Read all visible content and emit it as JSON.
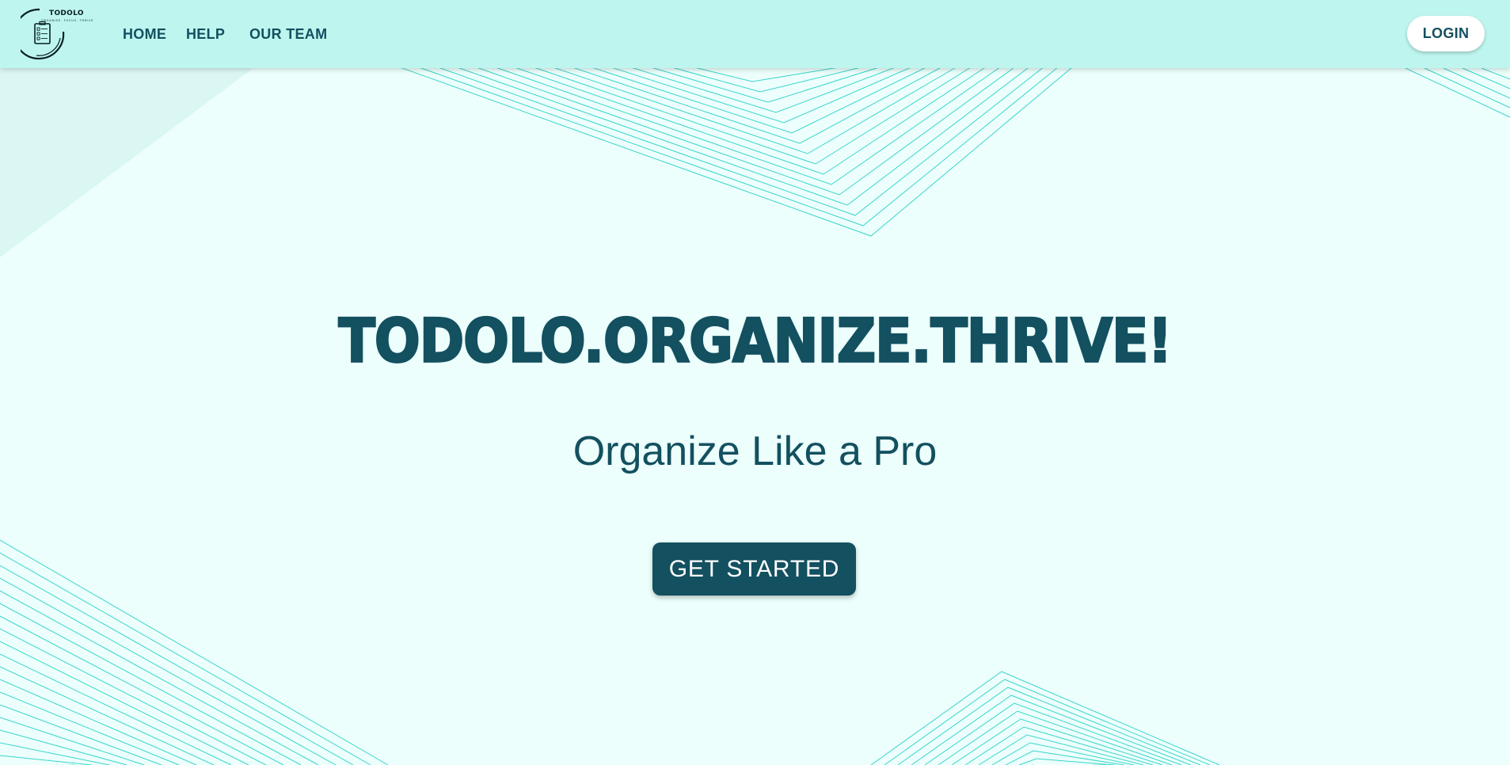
{
  "brand": {
    "name": "TODOLO",
    "tagline": "ORGANIZE. FOCUS. THRIVE"
  },
  "nav": {
    "home_label": "HOME",
    "help_label": "HELP",
    "team_label": "OUR TEAM",
    "login_label": "LOGIN"
  },
  "hero": {
    "title": "TODOLO.ORGANIZE.THRIVE!",
    "subtitle": "Organize Like a Pro",
    "cta_label": "GET STARTED"
  },
  "colors": {
    "navbar_bg": "#bef6ef",
    "page_bg": "#ecfffc",
    "primary": "#135060",
    "accent_lines": "#1ccdc3",
    "button_text": "#ffffff"
  },
  "icons": {
    "logo": "checklist-clipboard-icon"
  }
}
